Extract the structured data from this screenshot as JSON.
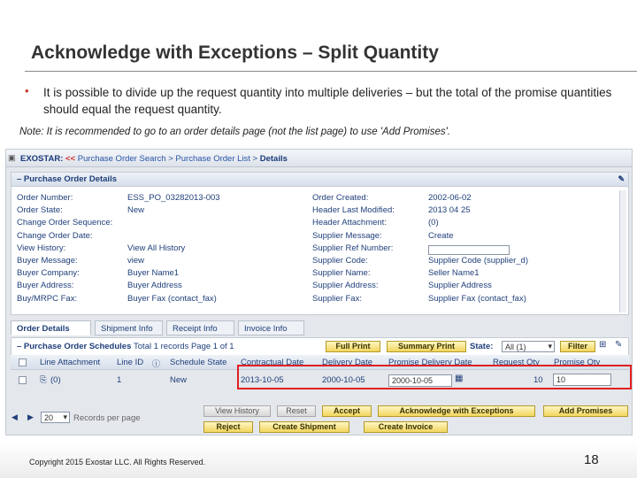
{
  "slide": {
    "title": "Acknowledge with Exceptions – Split Quantity",
    "bullet_mark": "•",
    "bullet": "It is possible to divide up the request quantity into multiple deliveries – but the total of the promise quantities should equal the request quantity.",
    "note": "Note:  It is recommended to go to an order details page (not the list page) to use 'Add Promises'.",
    "copyright": "Copyright 2015 Exostar LLC. All Rights Reserved.",
    "page_number": "18"
  },
  "app": {
    "brand": "EXOSTAR:",
    "back": "<<",
    "crumbs": [
      "Purchase Order Search",
      "Purchase Order List",
      "Details"
    ],
    "crumb_sep": ">",
    "panel_title": "– Purchase Order Details",
    "left_fields": [
      {
        "label": "Order Number:",
        "value": "ESS_PO_03282013-003"
      },
      {
        "label": "Order State:",
        "value": "New"
      },
      {
        "label": "Change Order Sequence:",
        "value": ""
      },
      {
        "label": "Change Order Date:",
        "value": ""
      },
      {
        "label": "View History:",
        "value": "View All History"
      },
      {
        "label": "Buyer Message:",
        "value": "view"
      },
      {
        "label": "Buyer Company:",
        "value": "Buyer Name1"
      },
      {
        "label": "Buyer Address:",
        "value": "Buyer Address"
      },
      {
        "label": "Buy/MRPC Fax:",
        "value": "Buyer Fax (contact_fax)"
      }
    ],
    "right_fields": [
      {
        "label": "Order Created:",
        "value": "2002-06-02"
      },
      {
        "label": "Header Last Modified:",
        "value": "2013 04 25"
      },
      {
        "label": "Header Attachment:",
        "value": "(0)"
      },
      {
        "label": "Supplier Message:",
        "value": "Create"
      },
      {
        "label": "Supplier Ref Number:",
        "value": ""
      },
      {
        "label": "Supplier Code:",
        "value": "Supplier Code (supplier_d)"
      },
      {
        "label": "Supplier Name:",
        "value": "Seller Name1"
      },
      {
        "label": "Supplier Address:",
        "value": "Supplier Address"
      },
      {
        "label": "Supplier Fax:",
        "value": "Supplier Fax (contact_fax)"
      }
    ],
    "tabs": [
      "Order Details",
      "Shipment Info",
      "Receipt Info",
      "Invoice Info"
    ],
    "schedules": {
      "title": "– Purchase Order Schedules",
      "summary": "Total 1 records Page 1 of 1",
      "full_print": "Full Print",
      "summary_print": "Summary Print",
      "state_label": "State:",
      "state_value": "All (1)",
      "filter": "Filter"
    },
    "columns": [
      "Line Attachment",
      "Line ID",
      "Schedule State",
      "Contractual Date",
      "Delivery Date",
      "Promise Delivery Date",
      "Request Qty",
      "Promise Qty"
    ],
    "row": {
      "attachment": "(0)",
      "line_id": "1",
      "state": "New",
      "contractual": "2013-10-05",
      "delivery": "2000-10-05",
      "promise_date": "2000-10-05",
      "request_qty": "10",
      "promise_qty": "10"
    },
    "pager": {
      "per_page": "20",
      "label": "Records per page"
    },
    "buttons": {
      "view_history": "View History",
      "reset": "Reset",
      "accept": "Accept",
      "ack_exceptions": "Acknowledge with Exceptions",
      "add_promises": "Add Promises",
      "reject": "Reject",
      "create_shipment": "Create Shipment",
      "create_invoice": "Create Invoice"
    }
  }
}
